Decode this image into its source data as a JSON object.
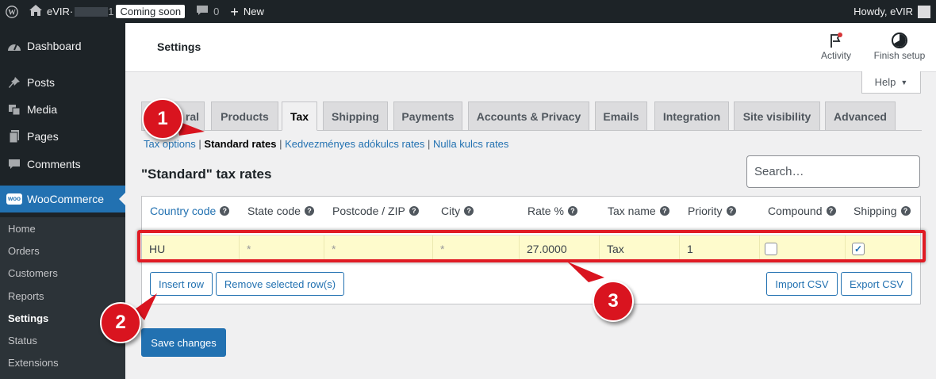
{
  "adminbar": {
    "site_name": "eVIR·",
    "site_suffix": "1",
    "coming_soon": "Coming soon",
    "comments_count": "0",
    "new_label": "New",
    "howdy": "Howdy, eVIR"
  },
  "sidebar": {
    "dashboard": "Dashboard",
    "posts": "Posts",
    "media": "Media",
    "pages": "Pages",
    "comments": "Comments",
    "woocommerce": "WooCommerce",
    "woo_badge": "woo",
    "submenu": [
      "Home",
      "Orders",
      "Customers",
      "Reports",
      "Settings",
      "Status",
      "Extensions"
    ]
  },
  "header": {
    "title": "Settings",
    "activity": "Activity",
    "finish_setup": "Finish setup",
    "help": "Help"
  },
  "tabs": [
    "General",
    "Products",
    "Tax",
    "Shipping",
    "Payments",
    "Accounts & Privacy",
    "Emails",
    "Integration",
    "Site visibility",
    "Advanced"
  ],
  "tab_general_visible": "ral",
  "subnav": {
    "tax_options": "Tax options",
    "standard_rates": "Standard rates",
    "reduced": "Kedvezményes adókulcs rates",
    "zero": "Nulla kulcs rates",
    "sep": "|"
  },
  "section_title": "\"Standard\" tax rates",
  "search": {
    "placeholder": "Search…"
  },
  "table": {
    "headers": [
      "Country code",
      "State code",
      "Postcode / ZIP",
      "City",
      "Rate %",
      "Tax name",
      "Priority",
      "Compound",
      "Shipping"
    ],
    "help_glyph": "?",
    "row": {
      "country": "HU",
      "state": "*",
      "postcode": "*",
      "city": "*",
      "rate": "27.0000",
      "tax_name": "Tax",
      "priority": "1",
      "compound": false,
      "shipping": true
    }
  },
  "buttons": {
    "insert_row": "Insert row",
    "remove_rows": "Remove selected row(s)",
    "import_csv": "Import CSV",
    "export_csv": "Export CSV",
    "save": "Save changes"
  },
  "callouts": [
    "1",
    "2",
    "3"
  ],
  "colors": {
    "accent": "#2271b1",
    "callout": "#d9141f",
    "row_highlight": "#fefbcc"
  }
}
